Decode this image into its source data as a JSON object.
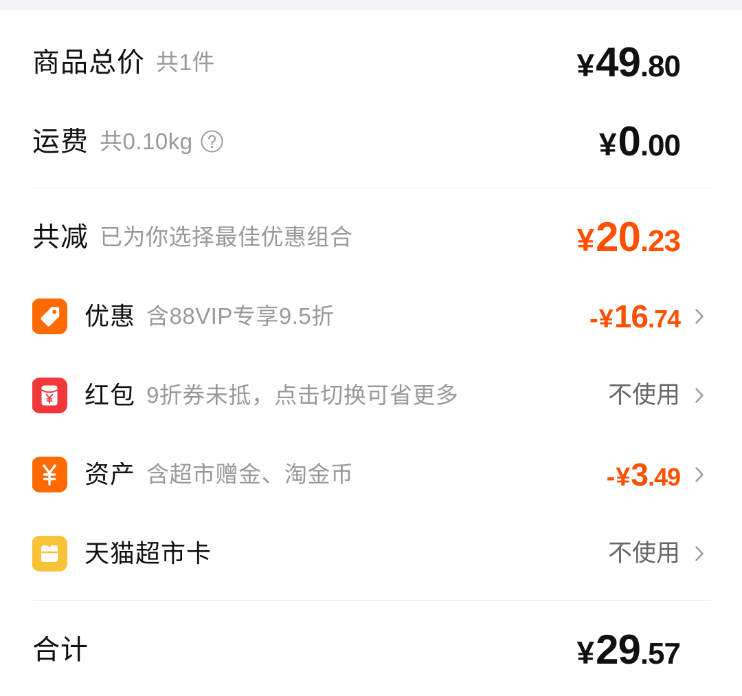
{
  "colors": {
    "text_primary": "#111111",
    "text_secondary": "#999999",
    "accent_orange": "#FF5000",
    "divider": "#EBEBEB"
  },
  "summary": {
    "goods_total": {
      "label": "商品总价",
      "note": "共1件",
      "amount": {
        "currency": "¥",
        "integer": "49",
        "decimal": ".80"
      }
    },
    "shipping": {
      "label": "运费",
      "note": "共0.10kg",
      "help_icon": "question-circle-icon",
      "amount": {
        "currency": "¥",
        "integer": "0",
        "decimal": ".00"
      }
    },
    "total_reduction": {
      "label": "共减",
      "note": "已为你选择最佳优惠组合",
      "amount": {
        "currency": "¥",
        "integer": "20",
        "decimal": ".23"
      }
    },
    "items": [
      {
        "icon": "discount-tag-icon",
        "icon_color": "#FF6A00",
        "label": "优惠",
        "note": "含88VIP专享9.5折",
        "amount": {
          "sign": "-",
          "currency": "¥",
          "integer": "16",
          "decimal": ".74"
        }
      },
      {
        "icon": "red-packet-icon",
        "icon_color": "#F0373A",
        "label": "红包",
        "note": "9折券未抵，点击切换可省更多",
        "status": "不使用"
      },
      {
        "icon": "yen-coin-icon",
        "icon_color": "#FF6A00",
        "label": "资产",
        "note": "含超市赠金、淘金币",
        "amount": {
          "sign": "-",
          "currency": "¥",
          "integer": "3",
          "decimal": ".49"
        }
      },
      {
        "icon": "supermarket-card-icon",
        "icon_color": "#F7C236",
        "label": "天猫超市卡",
        "status": "不使用"
      }
    ],
    "total": {
      "label": "合计",
      "amount": {
        "currency": "¥",
        "integer": "29",
        "decimal": ".57"
      }
    }
  }
}
